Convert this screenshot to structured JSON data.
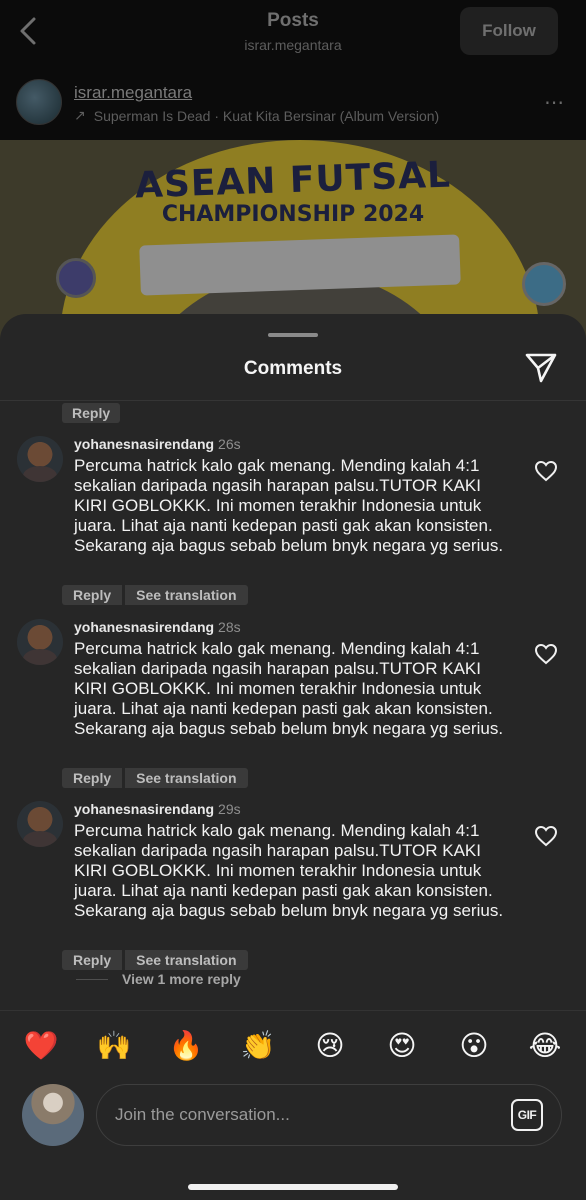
{
  "topbar": {
    "title": "Posts",
    "subtitle": "israr.megantara",
    "follow_label": "Follow"
  },
  "post": {
    "username": "israr.megantara",
    "music_arrow": "↗",
    "music": "Superman Is Dead · Kuat Kita Bersinar (Album Version)",
    "more_icon": "⋯",
    "banner_title": "ASEAN FUTSAL",
    "banner_subtitle": "CHAMPIONSHIP 2024"
  },
  "sheet": {
    "title": "Comments",
    "share_icon": "paper-plane-icon",
    "top_reply_label": "Reply"
  },
  "comments": [
    {
      "username": "yohanesnasirendang",
      "time": "26s",
      "text": "Percuma hatrick kalo gak menang. Mending kalah 4:1 sekalian daripada ngasih harapan palsu.TUTOR KAKI KIRI GOBLOKKK. Ini momen terakhir Indonesia untuk juara. Lihat aja nanti kedepan pasti gak akan konsisten. Sekarang aja bagus sebab belum bnyk negara yg serius.",
      "reply_label": "Reply",
      "translate_label": "See translation"
    },
    {
      "username": "yohanesnasirendang",
      "time": "28s",
      "text": "Percuma hatrick kalo gak menang. Mending kalah 4:1 sekalian daripada ngasih harapan palsu.TUTOR KAKI KIRI GOBLOKKK. Ini momen terakhir Indonesia untuk juara. Lihat aja nanti kedepan pasti gak akan konsisten. Sekarang aja bagus sebab belum bnyk negara yg serius.",
      "reply_label": "Reply",
      "translate_label": "See translation"
    },
    {
      "username": "yohanesnasirendang",
      "time": "29s",
      "text": "Percuma hatrick kalo gak menang. Mending kalah 4:1 sekalian daripada ngasih harapan palsu.TUTOR KAKI KIRI GOBLOKKK. Ini momen terakhir Indonesia untuk juara. Lihat aja nanti kedepan pasti gak akan konsisten. Sekarang aja bagus sebab belum bnyk negara yg serius.",
      "reply_label": "Reply",
      "translate_label": "See translation"
    }
  ],
  "view_more_replies": "View 1 more reply",
  "emoji_reactions": [
    "❤️",
    "🙌",
    "🔥",
    "👏",
    "😢",
    "😍",
    "😮",
    "😂"
  ],
  "composer": {
    "placeholder": "Join the conversation...",
    "gif_label": "GIF"
  },
  "colors": {
    "sheet_bg": "#262626",
    "pill_bg": "#3a3a3a",
    "text_primary": "#f5f5f5",
    "text_secondary": "#8e8e8e"
  }
}
